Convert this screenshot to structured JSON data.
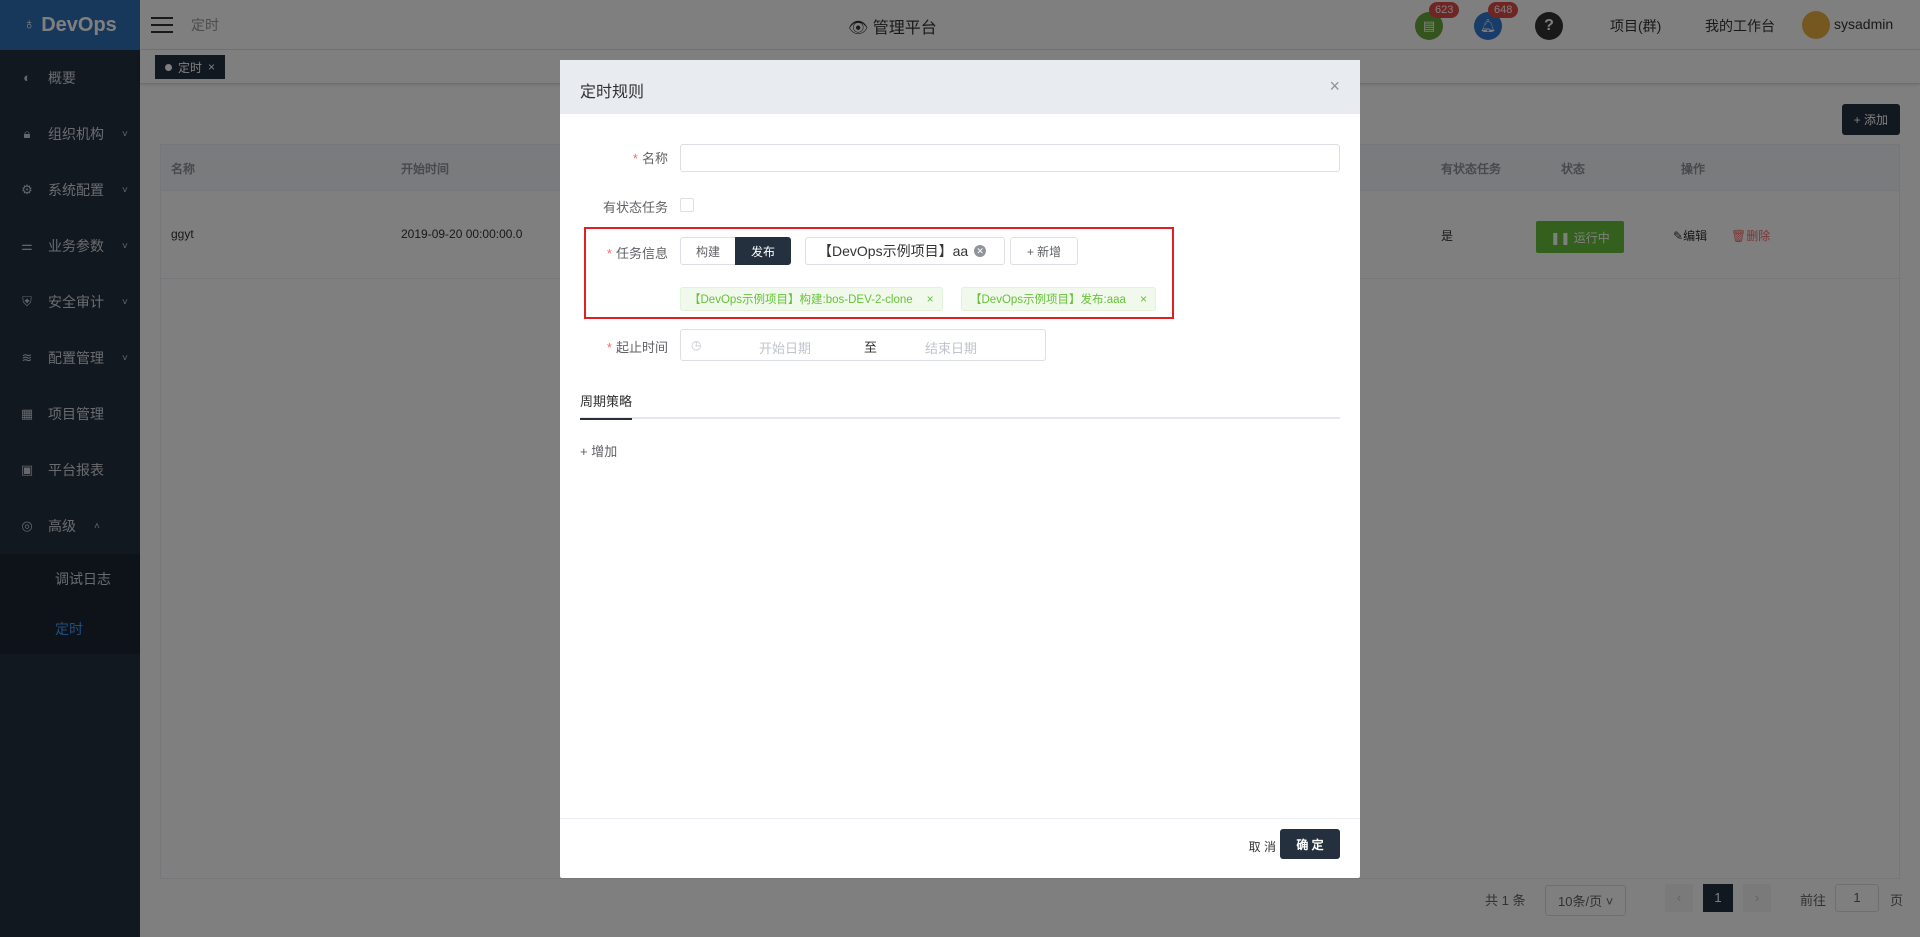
{
  "sidebar": {
    "logo": "DevOps",
    "items": [
      {
        "label": "概要",
        "icon": "dashboard-icon",
        "glyph": "◐",
        "chev": ""
      },
      {
        "label": "组织机构",
        "icon": "lock-icon",
        "glyph": "🔒︎",
        "chev": "˅"
      },
      {
        "label": "系统配置",
        "icon": "gear-icon",
        "glyph": "⚙",
        "chev": "˅"
      },
      {
        "label": "业务参数",
        "icon": "sliders-icon",
        "glyph": "⚌",
        "chev": "˅"
      },
      {
        "label": "安全审计",
        "icon": "shield-icon",
        "glyph": "⛨",
        "chev": "˅"
      },
      {
        "label": "配置管理",
        "icon": "database-icon",
        "glyph": "≋",
        "chev": "˅"
      },
      {
        "label": "项目管理",
        "icon": "grid-icon",
        "glyph": "▦",
        "chev": ""
      },
      {
        "label": "平台报表",
        "icon": "monitor-icon",
        "glyph": "▣",
        "chev": ""
      },
      {
        "label": "高级",
        "icon": "advanced-icon",
        "glyph": "◎",
        "chev": "˄"
      }
    ],
    "subitems": [
      {
        "label": "调试日志"
      },
      {
        "label": "定时"
      }
    ]
  },
  "topbar": {
    "breadcrumb": "定时",
    "platform": "管理平台",
    "badge1": "623",
    "badge2": "648",
    "help": "?",
    "projects": "项目(群)",
    "workspace": "我的工作台",
    "user": "sysadmin"
  },
  "tagsbar": {
    "tab_label": "定时",
    "tab_close": "×"
  },
  "page": {
    "add_label": "+ 添加",
    "columns": [
      "名称",
      "开始时间",
      "有状态任务",
      "状态",
      "操作"
    ],
    "row": {
      "name": "ggyt",
      "start": "2019-09-20 00:00:00.0",
      "stateful": "是",
      "status": "❚❚ 运行中",
      "edit": "编辑",
      "delete": "删除"
    },
    "pager": {
      "total": "共 1 条",
      "size": "10条/页",
      "current": "1",
      "goto": "前往",
      "goto_val": "1",
      "page_unit": "页"
    }
  },
  "dialog": {
    "title": "定时规则",
    "close": "×",
    "name_label": "名称",
    "stateful_label": "有状态任务",
    "task_label": "任务信息",
    "seg_build": "构建",
    "seg_release": "发布",
    "select_value": "【DevOps示例项目】aa",
    "new_btn": "+ 新增",
    "tag1": "【DevOps示例项目】构建:bos-DEV-2-clone",
    "tag2": "【DevOps示例项目】发布:aaa",
    "tag_close": "×",
    "date_label": "起止时间",
    "start_placeholder": "开始日期",
    "date_sep": "至",
    "end_placeholder": "结束日期",
    "tab": "周期策略",
    "add_link": "+ 增加",
    "cancel": "取 消",
    "ok": "确 定"
  }
}
